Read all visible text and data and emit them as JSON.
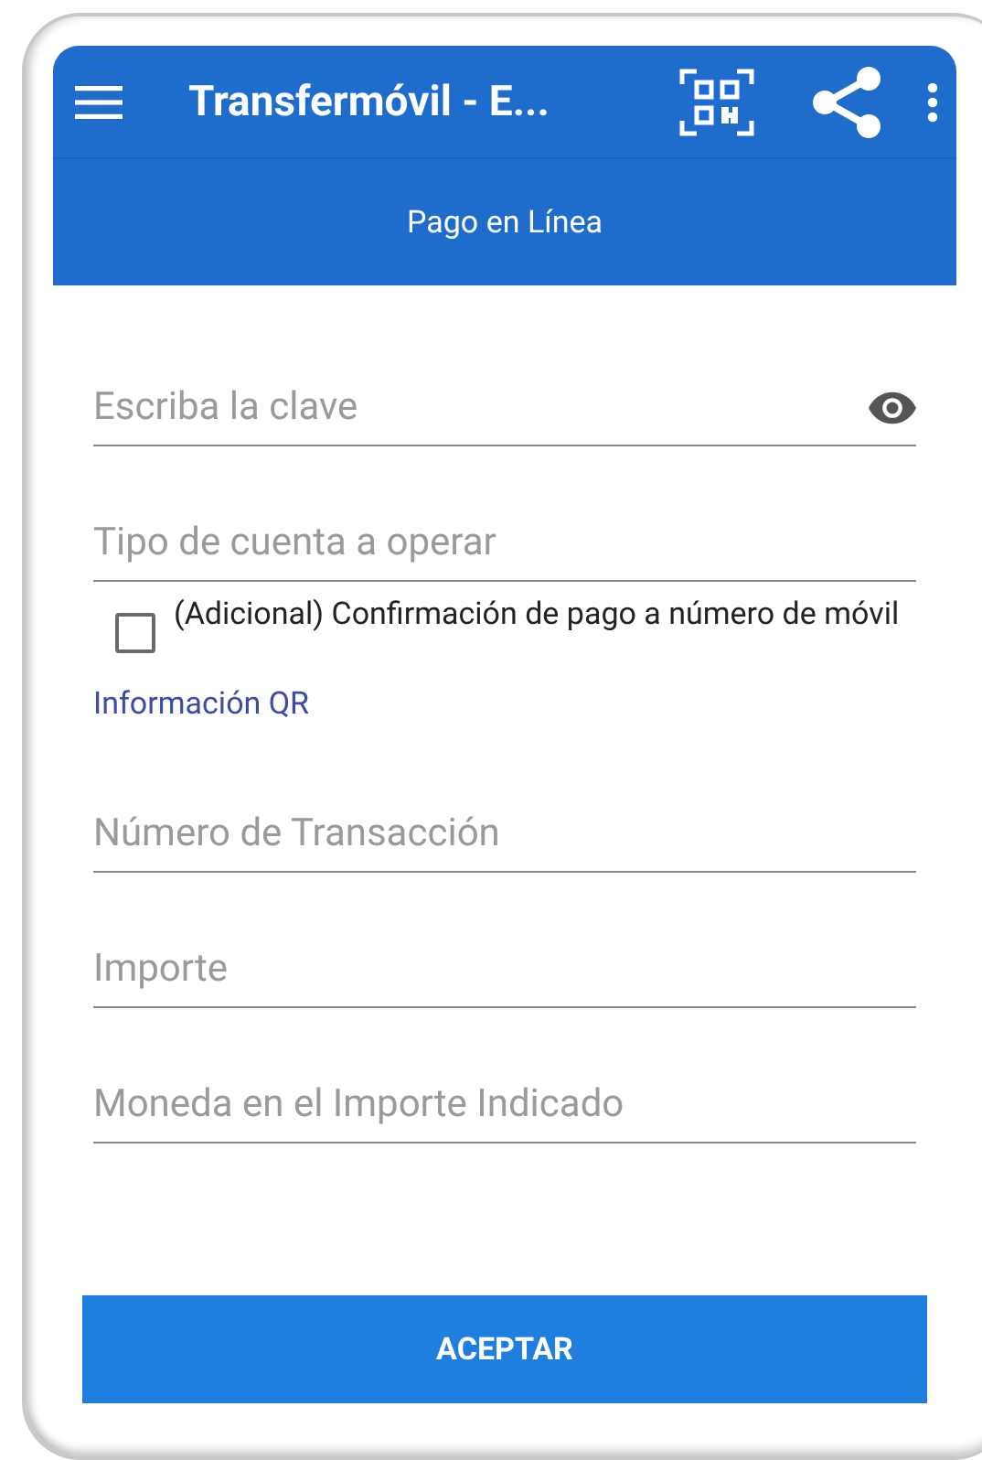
{
  "toolbar": {
    "title": "Transfermóvil - E..."
  },
  "header": {
    "title": "Pago en Línea"
  },
  "fields": [
    {
      "kind": "password",
      "placeholder": "Escriba la clave"
    },
    {
      "kind": "text",
      "placeholder": "Tipo de cuenta a operar"
    }
  ],
  "confirm_checkbox": {
    "label": "(Adicional) Confirmación de pago a número de móvil",
    "checked": false
  },
  "qr_link": "Información QR",
  "qr_fields": [
    {
      "placeholder": "Número de Transacción"
    },
    {
      "placeholder": "Importe"
    },
    {
      "placeholder": "Moneda en el Importe Indicado"
    }
  ],
  "button": "ACEPTAR"
}
